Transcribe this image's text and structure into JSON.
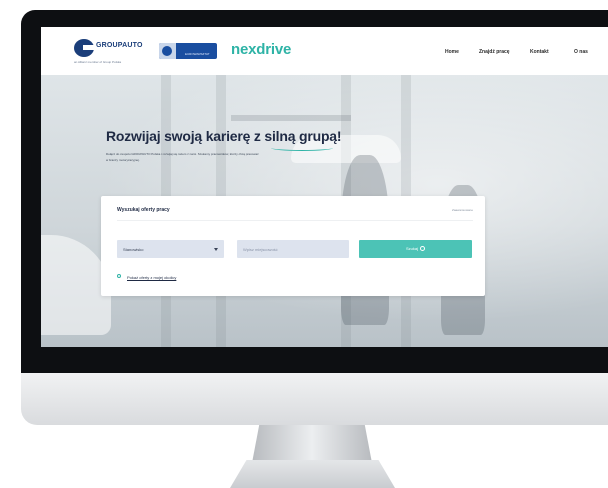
{
  "brand": {
    "group_logo_text": "GROUPAUTO",
    "group_logo_sub": "an Allianz member of Group Polska",
    "euro_logo_text": "EUROWARSZTAT",
    "nexdrive": "nexdrive"
  },
  "nav": {
    "items": [
      "Home",
      "Znajdź pracę",
      "Kontakt",
      "O nas"
    ]
  },
  "hero": {
    "headline": "Rozwijaj swoją karierę z silną grupą!",
    "lead": "Dołącz do zespołu GROUPAUTO Polska i rozwijaj się razem z nami. Szukamy pracowników, którzy chcą pracować w branży motoryzacyjnej."
  },
  "search": {
    "title": "Wyszukaj oferty pracy",
    "advanced": "Zaawansowane",
    "select_value": "Stanowisko",
    "input_placeholder": "Wpisz miejscowość",
    "button_label": "Szukaj",
    "location_link": "Pokaż oferty z mojej okolicy"
  },
  "colors": {
    "accent": "#2eb3a6",
    "button": "#4cc3b6",
    "brand_blue": "#1b3e7a"
  }
}
